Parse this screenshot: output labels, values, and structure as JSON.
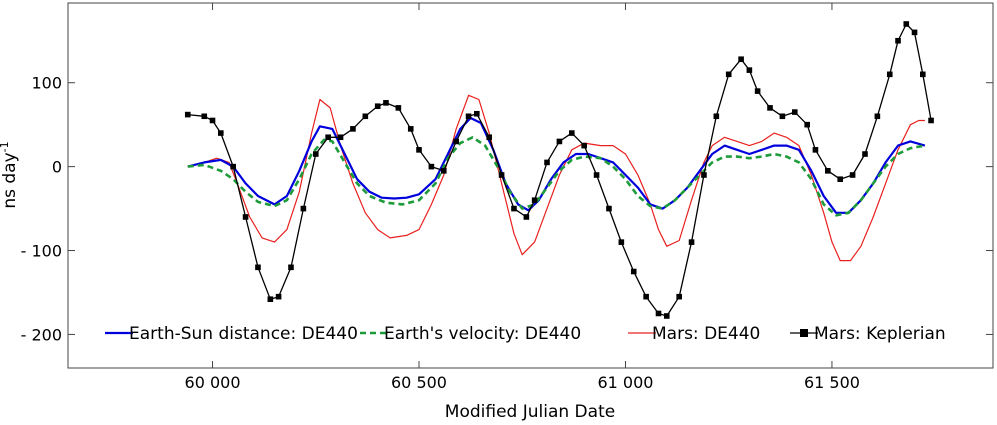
{
  "chart_data": {
    "type": "line",
    "xlabel": "Modified Julian Date",
    "ylabel": "ns day",
    "ylabel_sup": "-1",
    "xlim": [
      59650,
      61890
    ],
    "ylim": [
      -240,
      195
    ],
    "xticks": [
      60000,
      60500,
      61000,
      61500
    ],
    "xtick_labels": [
      "60 000",
      "60 500",
      "61 000",
      "61 500"
    ],
    "yticks": [
      -200,
      -100,
      0,
      100
    ],
    "ytick_labels": [
      "- 200",
      "- 100",
      "0",
      "100"
    ],
    "grid": false,
    "legend_placement": "bottom-center",
    "series": [
      {
        "name": "Earth-Sun distance: DE440",
        "color": "#0000dd",
        "style": "solid",
        "points": [
          [
            59940,
            0
          ],
          [
            59980,
            5
          ],
          [
            60020,
            8
          ],
          [
            60050,
            0
          ],
          [
            60080,
            -20
          ],
          [
            60110,
            -35
          ],
          [
            60150,
            -45
          ],
          [
            60180,
            -35
          ],
          [
            60210,
            -5
          ],
          [
            60240,
            30
          ],
          [
            60260,
            48
          ],
          [
            60290,
            45
          ],
          [
            60320,
            15
          ],
          [
            60350,
            -15
          ],
          [
            60380,
            -30
          ],
          [
            60410,
            -37
          ],
          [
            60440,
            -38
          ],
          [
            60470,
            -37
          ],
          [
            60500,
            -33
          ],
          [
            60540,
            -15
          ],
          [
            60570,
            15
          ],
          [
            60600,
            45
          ],
          [
            60625,
            58
          ],
          [
            60650,
            52
          ],
          [
            60680,
            20
          ],
          [
            60710,
            -20
          ],
          [
            60740,
            -45
          ],
          [
            60765,
            -52
          ],
          [
            60790,
            -40
          ],
          [
            60820,
            -15
          ],
          [
            60850,
            5
          ],
          [
            60880,
            15
          ],
          [
            60910,
            15
          ],
          [
            60940,
            10
          ],
          [
            60970,
            5
          ],
          [
            61000,
            -10
          ],
          [
            61030,
            -25
          ],
          [
            61060,
            -45
          ],
          [
            61090,
            -50
          ],
          [
            61120,
            -40
          ],
          [
            61150,
            -25
          ],
          [
            61180,
            -5
          ],
          [
            61210,
            15
          ],
          [
            61240,
            25
          ],
          [
            61270,
            20
          ],
          [
            61300,
            15
          ],
          [
            61330,
            20
          ],
          [
            61360,
            25
          ],
          [
            61390,
            25
          ],
          [
            61420,
            20
          ],
          [
            61450,
            -5
          ],
          [
            61480,
            -35
          ],
          [
            61510,
            -55
          ],
          [
            61540,
            -55
          ],
          [
            61570,
            -40
          ],
          [
            61600,
            -20
          ],
          [
            61630,
            5
          ],
          [
            61660,
            25
          ],
          [
            61690,
            30
          ],
          [
            61725,
            25
          ]
        ]
      },
      {
        "name": "Earth's velocity: DE440",
        "color": "#1e9b3a",
        "style": "dashed",
        "points": [
          [
            59940,
            0
          ],
          [
            59980,
            2
          ],
          [
            60020,
            -5
          ],
          [
            60050,
            -15
          ],
          [
            60080,
            -30
          ],
          [
            60110,
            -42
          ],
          [
            60150,
            -47
          ],
          [
            60180,
            -40
          ],
          [
            60210,
            -15
          ],
          [
            60240,
            15
          ],
          [
            60270,
            32
          ],
          [
            60290,
            30
          ],
          [
            60320,
            5
          ],
          [
            60350,
            -20
          ],
          [
            60380,
            -35
          ],
          [
            60420,
            -43
          ],
          [
            60460,
            -45
          ],
          [
            60500,
            -40
          ],
          [
            60540,
            -20
          ],
          [
            60570,
            10
          ],
          [
            60600,
            28
          ],
          [
            60630,
            35
          ],
          [
            60660,
            25
          ],
          [
            60690,
            0
          ],
          [
            60720,
            -30
          ],
          [
            60750,
            -50
          ],
          [
            60780,
            -45
          ],
          [
            60810,
            -25
          ],
          [
            60840,
            -5
          ],
          [
            60870,
            8
          ],
          [
            60900,
            12
          ],
          [
            60940,
            10
          ],
          [
            60970,
            0
          ],
          [
            61000,
            -15
          ],
          [
            61030,
            -35
          ],
          [
            61060,
            -47
          ],
          [
            61090,
            -50
          ],
          [
            61120,
            -40
          ],
          [
            61150,
            -25
          ],
          [
            61180,
            -10
          ],
          [
            61210,
            5
          ],
          [
            61240,
            12
          ],
          [
            61270,
            12
          ],
          [
            61300,
            10
          ],
          [
            61330,
            12
          ],
          [
            61360,
            15
          ],
          [
            61390,
            12
          ],
          [
            61420,
            5
          ],
          [
            61450,
            -15
          ],
          [
            61480,
            -45
          ],
          [
            61510,
            -58
          ],
          [
            61540,
            -55
          ],
          [
            61570,
            -40
          ],
          [
            61600,
            -20
          ],
          [
            61630,
            0
          ],
          [
            61660,
            15
          ],
          [
            61690,
            22
          ],
          [
            61725,
            25
          ]
        ]
      },
      {
        "name": "Mars: DE440",
        "color": "#e8201e",
        "style": "solid-thin",
        "points": [
          [
            59940,
            0
          ],
          [
            59980,
            5
          ],
          [
            60010,
            10
          ],
          [
            60040,
            5
          ],
          [
            60060,
            -20
          ],
          [
            60090,
            -60
          ],
          [
            60120,
            -85
          ],
          [
            60150,
            -90
          ],
          [
            60180,
            -75
          ],
          [
            60210,
            -30
          ],
          [
            60240,
            40
          ],
          [
            60260,
            80
          ],
          [
            60285,
            70
          ],
          [
            60310,
            25
          ],
          [
            60340,
            -20
          ],
          [
            60370,
            -55
          ],
          [
            60400,
            -75
          ],
          [
            60430,
            -85
          ],
          [
            60470,
            -82
          ],
          [
            60500,
            -75
          ],
          [
            60530,
            -45
          ],
          [
            60560,
            -10
          ],
          [
            60590,
            45
          ],
          [
            60620,
            85
          ],
          [
            60645,
            80
          ],
          [
            60670,
            40
          ],
          [
            60700,
            -20
          ],
          [
            60730,
            -80
          ],
          [
            60750,
            -105
          ],
          [
            60780,
            -90
          ],
          [
            60810,
            -50
          ],
          [
            60840,
            -10
          ],
          [
            60870,
            20
          ],
          [
            60900,
            28
          ],
          [
            60940,
            25
          ],
          [
            60970,
            25
          ],
          [
            61000,
            15
          ],
          [
            61030,
            -10
          ],
          [
            61060,
            -45
          ],
          [
            61080,
            -75
          ],
          [
            61100,
            -95
          ],
          [
            61130,
            -88
          ],
          [
            61160,
            -40
          ],
          [
            61190,
            5
          ],
          [
            61210,
            25
          ],
          [
            61240,
            35
          ],
          [
            61270,
            30
          ],
          [
            61300,
            25
          ],
          [
            61330,
            30
          ],
          [
            61360,
            40
          ],
          [
            61390,
            35
          ],
          [
            61420,
            25
          ],
          [
            61450,
            -10
          ],
          [
            61480,
            -55
          ],
          [
            61500,
            -90
          ],
          [
            61520,
            -112
          ],
          [
            61545,
            -112
          ],
          [
            61570,
            -95
          ],
          [
            61600,
            -60
          ],
          [
            61630,
            -20
          ],
          [
            61660,
            20
          ],
          [
            61690,
            50
          ],
          [
            61710,
            55
          ],
          [
            61725,
            55
          ]
        ]
      },
      {
        "name": "Mars: Keplerian",
        "color": "#000000",
        "style": "solid-markers",
        "points": [
          [
            59940,
            62
          ],
          [
            59980,
            60
          ],
          [
            60000,
            55
          ],
          [
            60020,
            40
          ],
          [
            60050,
            0
          ],
          [
            60080,
            -60
          ],
          [
            60110,
            -120
          ],
          [
            60140,
            -158
          ],
          [
            60160,
            -155
          ],
          [
            60190,
            -120
          ],
          [
            60220,
            -50
          ],
          [
            60250,
            15
          ],
          [
            60280,
            35
          ],
          [
            60310,
            35
          ],
          [
            60340,
            45
          ],
          [
            60370,
            60
          ],
          [
            60400,
            72
          ],
          [
            60420,
            76
          ],
          [
            60450,
            70
          ],
          [
            60480,
            45
          ],
          [
            60500,
            20
          ],
          [
            60530,
            0
          ],
          [
            60560,
            -5
          ],
          [
            60590,
            30
          ],
          [
            60620,
            60
          ],
          [
            60640,
            63
          ],
          [
            60670,
            35
          ],
          [
            60700,
            -10
          ],
          [
            60730,
            -50
          ],
          [
            60760,
            -60
          ],
          [
            60780,
            -40
          ],
          [
            60810,
            5
          ],
          [
            60840,
            30
          ],
          [
            60870,
            40
          ],
          [
            60900,
            25
          ],
          [
            60930,
            -10
          ],
          [
            60960,
            -50
          ],
          [
            60990,
            -90
          ],
          [
            61020,
            -125
          ],
          [
            61050,
            -155
          ],
          [
            61080,
            -175
          ],
          [
            61100,
            -178
          ],
          [
            61130,
            -155
          ],
          [
            61160,
            -90
          ],
          [
            61190,
            -10
          ],
          [
            61220,
            60
          ],
          [
            61250,
            110
          ],
          [
            61280,
            128
          ],
          [
            61300,
            115
          ],
          [
            61320,
            90
          ],
          [
            61350,
            70
          ],
          [
            61380,
            60
          ],
          [
            61410,
            65
          ],
          [
            61440,
            50
          ],
          [
            61460,
            20
          ],
          [
            61490,
            -5
          ],
          [
            61520,
            -15
          ],
          [
            61550,
            -10
          ],
          [
            61580,
            15
          ],
          [
            61610,
            60
          ],
          [
            61640,
            110
          ],
          [
            61660,
            150
          ],
          [
            61680,
            170
          ],
          [
            61700,
            160
          ],
          [
            61720,
            110
          ],
          [
            61740,
            55
          ]
        ]
      }
    ]
  }
}
